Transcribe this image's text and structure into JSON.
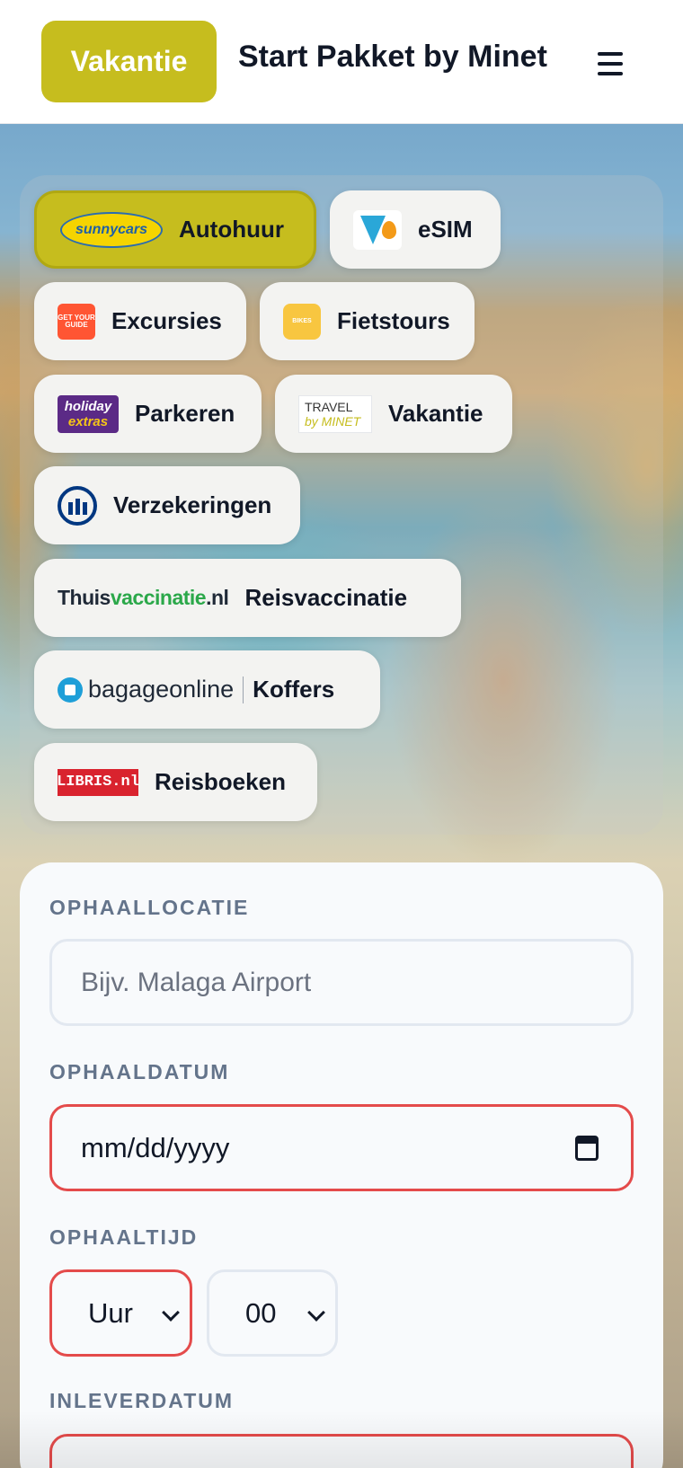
{
  "header": {
    "brand_button": "Vakantie",
    "site_title": "Start Pakket by Minet",
    "menu_icon": "hamburger-menu-icon"
  },
  "categories": [
    {
      "logo": "sunnycars",
      "label": "Autohuur",
      "active": true
    },
    {
      "logo": "esim",
      "label": "eSIM"
    },
    {
      "logo": "getyourguide",
      "logo_text": "GET YOUR GUIDE",
      "label": "Excursies"
    },
    {
      "logo": "bike-tours",
      "logo_text": "BIKES",
      "label": "Fietstours"
    },
    {
      "logo": "holiday-extras",
      "logo_line1": "holiday",
      "logo_line2": "extras",
      "label": "Parkeren"
    },
    {
      "logo": "travel-by-minet",
      "logo_line1": "TRAVEL",
      "logo_line2": "by MINET",
      "label": "Vakantie"
    },
    {
      "logo": "allianz",
      "label": "Verzekeringen"
    },
    {
      "logo": "thuisvaccinatie",
      "logo_part1": "Thuis",
      "logo_part2": "vaccinatie",
      "logo_part3": ".nl",
      "label": "Reisvaccinatie"
    },
    {
      "logo": "bagageonline",
      "logo_text": "bagageonline",
      "label": "Koffers"
    },
    {
      "logo": "libris",
      "logo_text": "LIBRIS.nl",
      "label": "Reisboeken"
    }
  ],
  "sunnycars_text": "sunnycars",
  "form": {
    "pickup_location": {
      "label": "OPHAALLOCATIE",
      "placeholder": "Bijv. Malaga Airport"
    },
    "pickup_date": {
      "label": "OPHAALDATUM",
      "value": "mm/dd/yyyy"
    },
    "pickup_time": {
      "label": "OPHAALTIJD",
      "hour": "Uur",
      "minute": "00"
    },
    "return_date": {
      "label": "INLEVERDATUM"
    }
  },
  "colors": {
    "accent": "#c6bd1e",
    "error": "#e44b4b",
    "label": "#64748b"
  }
}
